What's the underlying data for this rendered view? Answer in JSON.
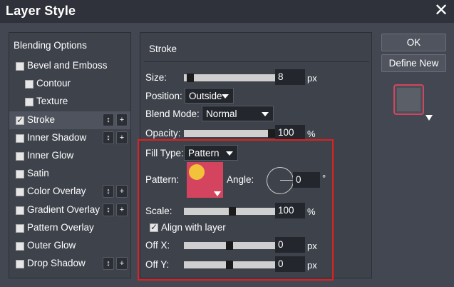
{
  "window": {
    "title": "Layer Style"
  },
  "left": {
    "header": "Blending Options",
    "items": [
      {
        "label": "Bevel and Emboss",
        "checked": false,
        "indent": false,
        "buttons": false,
        "selected": false
      },
      {
        "label": "Contour",
        "checked": false,
        "indent": true,
        "buttons": false,
        "selected": false
      },
      {
        "label": "Texture",
        "checked": false,
        "indent": true,
        "buttons": false,
        "selected": false
      },
      {
        "label": "Stroke",
        "checked": true,
        "indent": false,
        "buttons": true,
        "selected": true
      },
      {
        "label": "Inner Shadow",
        "checked": false,
        "indent": false,
        "buttons": true,
        "selected": false
      },
      {
        "label": "Inner Glow",
        "checked": false,
        "indent": false,
        "buttons": false,
        "selected": false
      },
      {
        "label": "Satin",
        "checked": false,
        "indent": false,
        "buttons": false,
        "selected": false
      },
      {
        "label": "Color Overlay",
        "checked": false,
        "indent": false,
        "buttons": true,
        "selected": false
      },
      {
        "label": "Gradient Overlay",
        "checked": false,
        "indent": false,
        "buttons": true,
        "selected": false
      },
      {
        "label": "Pattern Overlay",
        "checked": false,
        "indent": false,
        "buttons": false,
        "selected": false
      },
      {
        "label": "Outer Glow",
        "checked": false,
        "indent": false,
        "buttons": false,
        "selected": false
      },
      {
        "label": "Drop Shadow",
        "checked": false,
        "indent": false,
        "buttons": true,
        "selected": false
      }
    ],
    "move_glyph": "↕",
    "add_glyph": "+"
  },
  "stroke": {
    "title": "Stroke",
    "size": {
      "label": "Size:",
      "value": "8",
      "unit": "px"
    },
    "position": {
      "label": "Position:",
      "value": "Outside"
    },
    "blend_mode": {
      "label": "Blend Mode:",
      "value": "Normal"
    },
    "opacity": {
      "label": "Opacity:",
      "value": "100",
      "unit": "%"
    },
    "fill_type": {
      "label": "Fill Type:",
      "value": "Pattern"
    },
    "pattern": {
      "label": "Pattern:"
    },
    "angle": {
      "label": "Angle:",
      "value": "0",
      "unit": "°"
    },
    "scale": {
      "label": "Scale:",
      "value": "100",
      "unit": "%"
    },
    "align": {
      "label": "Align with layer",
      "checked": true
    },
    "off_x": {
      "label": "Off X:",
      "value": "0",
      "unit": "px"
    },
    "off_y": {
      "label": "Off Y:",
      "value": "0",
      "unit": "px"
    }
  },
  "buttons": {
    "ok": "OK",
    "define_new": "Define New"
  },
  "colors": {
    "accent_red": "#e02020",
    "pattern_bg": "#d4445f",
    "pattern_dot": "#f2c23a"
  }
}
